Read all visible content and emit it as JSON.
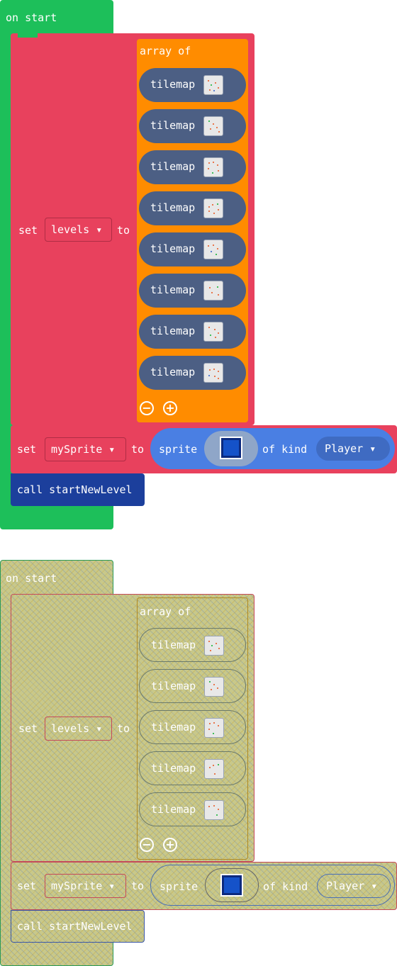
{
  "event": {
    "label": "on start"
  },
  "set_levels": {
    "set": "set",
    "variable": "levels",
    "to": "to"
  },
  "array_block": {
    "label": "array of"
  },
  "tilemap_label": "tilemap",
  "set_sprite": {
    "set": "set",
    "variable": "mySprite",
    "to": "to",
    "sprite": "sprite",
    "of_kind": "of kind",
    "kind": "Player"
  },
  "call_block": {
    "label": "call startNewLevel"
  },
  "icons": {
    "dropdown": "▾",
    "remove": "−",
    "add": "+"
  },
  "colors": {
    "event_green": "#1dbf5a",
    "variables_red": "#e8415d",
    "array_orange": "#ff8c00",
    "tilemap_slate": "#4c5f84",
    "sprite_blue": "#4a7fe3",
    "function_navy": "#1c3f9c"
  }
}
